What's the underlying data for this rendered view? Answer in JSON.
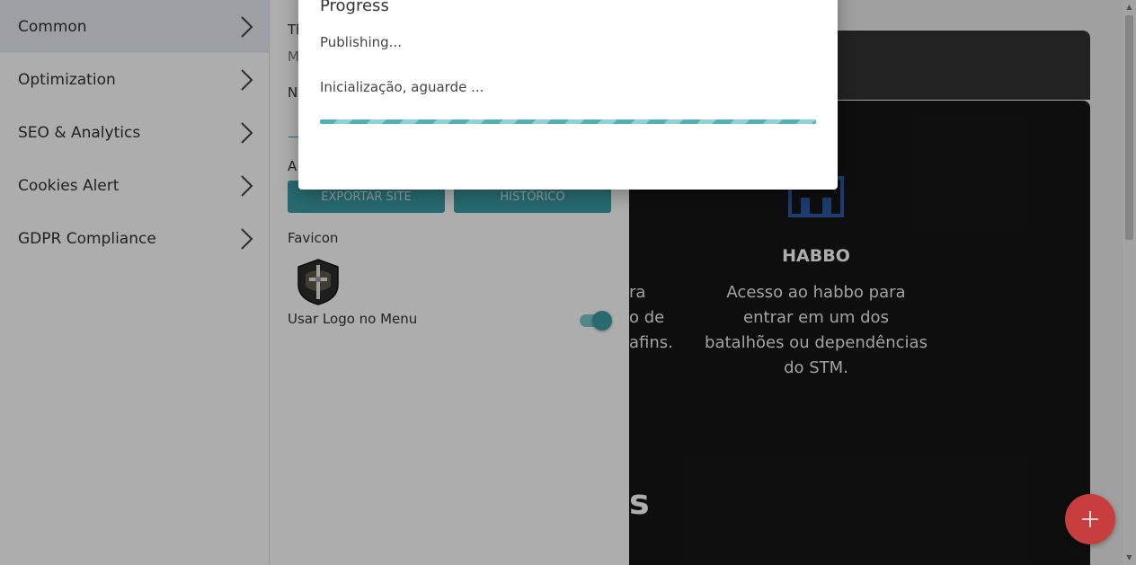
{
  "sidebar": {
    "items": [
      {
        "label": "Common"
      },
      {
        "label": "Optimization"
      },
      {
        "label": "SEO & Analytics"
      },
      {
        "label": "Cookies Alert"
      },
      {
        "label": "GDPR Compliance"
      }
    ]
  },
  "panel": {
    "fragments": [
      "Th",
      "M",
      "N",
      "A"
    ],
    "buttons": {
      "export_label": "EXPORTAR SITE",
      "history_label": "HISTÓRICO"
    },
    "favicon_label": "Favicon",
    "logo_menu_label": "Usar Logo no Menu",
    "logo_menu_toggle": true
  },
  "preview": {
    "card_title": "HABBO",
    "card_text": "Acesso ao habbo para entrar em um dos batalhões ou dependências do STM.",
    "clipped_text_lines": [
      "ra",
      "o de",
      "afins."
    ],
    "clipped_heading": "s"
  },
  "dialog": {
    "title": "Progress",
    "status": "Publishing...",
    "detail": "Inicialização, aguarde ..."
  },
  "colors": {
    "accent": "#3a9ea5",
    "fab": "#c83d3d",
    "sidebar_active": "#e6eaf0"
  },
  "icons": {
    "fab": "plus-icon",
    "sidebar_item": "chevron-right-icon"
  }
}
